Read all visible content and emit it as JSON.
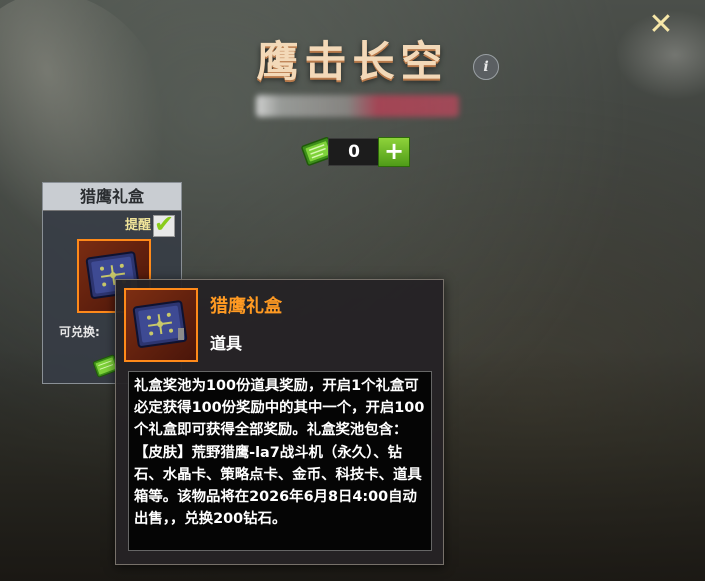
{
  "header": {
    "title": "鹰击长空",
    "info_icon": "info-icon",
    "close_icon": "close-icon"
  },
  "currency": {
    "icon": "ticket-icon",
    "amount": "0",
    "add_icon": "plus-icon"
  },
  "card": {
    "title": "猎鹰礼盒",
    "reminder_label": "提醒",
    "reminder_checked": true,
    "exchange_label": "可兑换:",
    "item_icon": "gift-box-icon"
  },
  "tooltip": {
    "name": "猎鹰礼盒",
    "type": "道具",
    "description": "礼盒奖池为100份道具奖励，开启1个礼盒可必定获得100份奖励中的其中一个，开启100个礼盒即可获得全部奖励。礼盒奖池包含：【皮肤】荒野猎鹰-la7战斗机（永久）、钻石、水晶卡、策略点卡、金币、科技卡、道具箱等。该物品将在2026年6月8日4:00自动出售，，兑换200钻石。"
  },
  "colors": {
    "title": "#f3d9b8",
    "item_border": "#ff8a1a",
    "item_name": "#ff9a22",
    "plus_button": "#6fbf24",
    "reminder": "#f0e49a"
  }
}
